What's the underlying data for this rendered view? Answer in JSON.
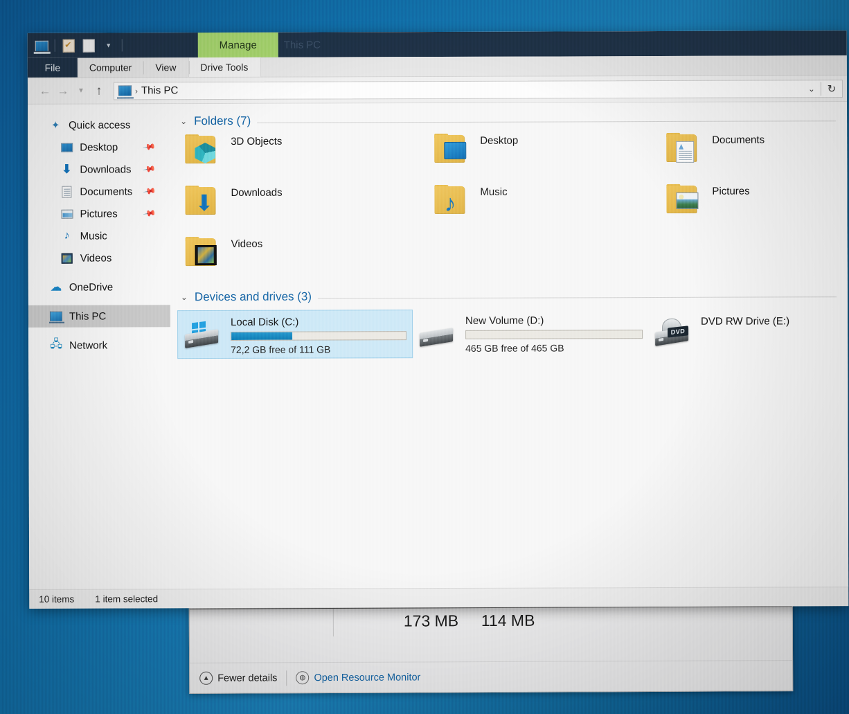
{
  "window": {
    "title": "This PC",
    "manage_tab": "Manage",
    "quick_access_icons": [
      "this-pc-icon",
      "properties-icon",
      "new-folder-icon",
      "chevron-down-icon"
    ]
  },
  "ribbon": {
    "file_tab": "File",
    "tabs": [
      "Computer",
      "View"
    ],
    "contextual_tab": "Drive Tools"
  },
  "addressbar": {
    "back_icon": "arrow-left-icon",
    "forward_icon": "arrow-right-icon",
    "history_icon": "chevron-down-icon",
    "up_icon": "arrow-up-icon",
    "crumb_icon": "this-pc-icon",
    "crumb_separator": "›",
    "path": "This PC",
    "dropdown_icon": "chevron-down-icon",
    "refresh_icon": "refresh-icon"
  },
  "sidebar": {
    "items": [
      {
        "label": "Quick access",
        "icon": "star-pin-icon",
        "indent": false,
        "pinned": false,
        "selected": false
      },
      {
        "label": "Desktop",
        "icon": "desktop-icon",
        "indent": true,
        "pinned": true,
        "selected": false
      },
      {
        "label": "Downloads",
        "icon": "download-arrow-icon",
        "indent": true,
        "pinned": true,
        "selected": false
      },
      {
        "label": "Documents",
        "icon": "document-icon",
        "indent": true,
        "pinned": true,
        "selected": false
      },
      {
        "label": "Pictures",
        "icon": "picture-icon",
        "indent": true,
        "pinned": true,
        "selected": false
      },
      {
        "label": "Music",
        "icon": "music-note-icon",
        "indent": true,
        "pinned": false,
        "selected": false
      },
      {
        "label": "Videos",
        "icon": "video-film-icon",
        "indent": true,
        "pinned": false,
        "selected": false
      },
      {
        "label": "OneDrive",
        "icon": "cloud-icon",
        "indent": false,
        "pinned": false,
        "selected": false
      },
      {
        "label": "This PC",
        "icon": "this-pc-icon",
        "indent": false,
        "pinned": false,
        "selected": true
      },
      {
        "label": "Network",
        "icon": "network-icon",
        "indent": false,
        "pinned": false,
        "selected": false
      }
    ],
    "pin_icon": "pushpin-icon"
  },
  "groups": {
    "folders": {
      "title": "Folders (7)",
      "collapse_icon": "chevron-down-icon",
      "items": [
        {
          "label": "3D Objects",
          "icon": "folder-3d-objects-icon"
        },
        {
          "label": "Desktop",
          "icon": "folder-desktop-icon"
        },
        {
          "label": "Documents",
          "icon": "folder-documents-icon"
        },
        {
          "label": "Downloads",
          "icon": "folder-downloads-icon"
        },
        {
          "label": "Music",
          "icon": "folder-music-icon"
        },
        {
          "label": "Pictures",
          "icon": "folder-pictures-icon"
        },
        {
          "label": "Videos",
          "icon": "folder-videos-icon"
        }
      ]
    },
    "devices": {
      "title": "Devices and drives (3)",
      "collapse_icon": "chevron-down-icon",
      "items": [
        {
          "label": "Local Disk (C:)",
          "icon": "windows-hard-drive-icon",
          "free_text": "72,2 GB free of 111 GB",
          "used_percent": 35,
          "has_bar": true,
          "selected": true
        },
        {
          "label": "New Volume (D:)",
          "icon": "hard-drive-icon",
          "free_text": "465 GB free of 465 GB",
          "used_percent": 0,
          "has_bar": true,
          "selected": false
        },
        {
          "label": "DVD RW Drive (E:)",
          "icon": "dvd-drive-icon",
          "badge": "DVD",
          "free_text": "",
          "has_bar": false,
          "selected": false
        }
      ]
    }
  },
  "statusbar": {
    "item_count": "10 items",
    "selection": "1 item selected"
  },
  "taskmanager": {
    "memory_values": [
      "173 MB",
      "114 MB"
    ],
    "fewer_details": "Fewer details",
    "fewer_details_icon": "chevron-up-circle-icon",
    "resource_monitor": "Open Resource Monitor",
    "resource_monitor_icon": "resource-monitor-icon"
  },
  "colors": {
    "titlebar": "#1f3247",
    "manage_tab": "#a6d46e",
    "group_title": "#1464a5",
    "selection": "#cde8f7",
    "bar_fill": "#0c7cb4",
    "link": "#1464a5",
    "desktop": "#1170ab"
  }
}
